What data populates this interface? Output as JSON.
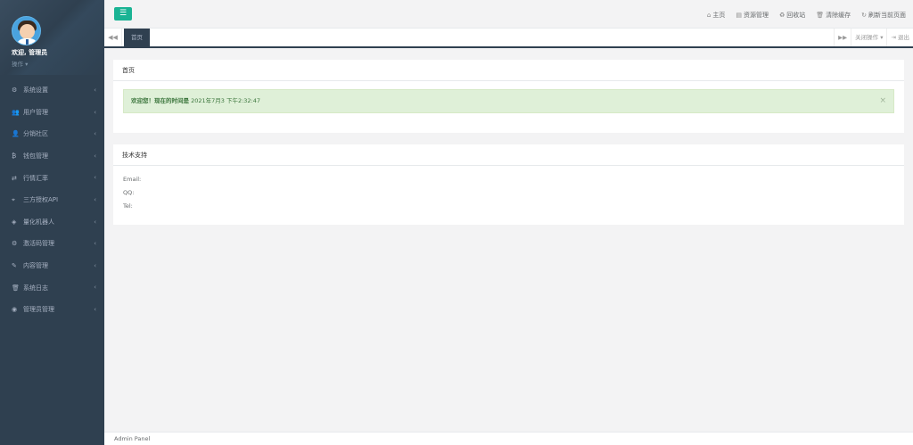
{
  "sidebar": {
    "welcome": "欢迎, 管理员",
    "ops_label": "操作 ▾",
    "items": [
      {
        "icon": "⚙",
        "label": "系统设置"
      },
      {
        "icon": "👥",
        "label": "用户管理"
      },
      {
        "icon": "👤",
        "label": "分销社区"
      },
      {
        "icon": "₿",
        "label": "钱包管理"
      },
      {
        "icon": "⇄",
        "label": "行情汇率"
      },
      {
        "icon": "⌖",
        "label": "三方授权API"
      },
      {
        "icon": "◈",
        "label": "量化机器人"
      },
      {
        "icon": "⚙",
        "label": "激活码管理"
      },
      {
        "icon": "✎",
        "label": "内容管理"
      },
      {
        "icon": "🗑",
        "label": "系统日志"
      },
      {
        "icon": "◉",
        "label": "管理员管理"
      }
    ]
  },
  "topbar": {
    "menu_icon": "☰",
    "links": [
      {
        "icon": "⌂",
        "label": "主页"
      },
      {
        "icon": "▤",
        "label": "资源管理"
      },
      {
        "icon": "♻",
        "label": "回收站"
      },
      {
        "icon": "🗑",
        "label": "清除缓存"
      },
      {
        "icon": "↻",
        "label": "刷新当前页面"
      }
    ]
  },
  "tabs": {
    "left_icon": "◀◀",
    "active": "首页",
    "right_icon": "▶▶",
    "close_ops": "关闭操作 ▾",
    "logout": "⇥ 退出"
  },
  "main": {
    "panel1_title": "首页",
    "alert_bold": "欢迎您！现在的时间是",
    "alert_time": " 2021年7月3 下午2:32:47",
    "alert_close": "×",
    "panel2_title": "技术支持",
    "info": [
      "Email:",
      "QQ:",
      "Tel:"
    ]
  },
  "footer": {
    "text": "Admin Panel"
  },
  "colors": {
    "sidebar_bg": "#2f4050",
    "accent": "#1ab394",
    "alert_bg": "#dff0d8"
  }
}
